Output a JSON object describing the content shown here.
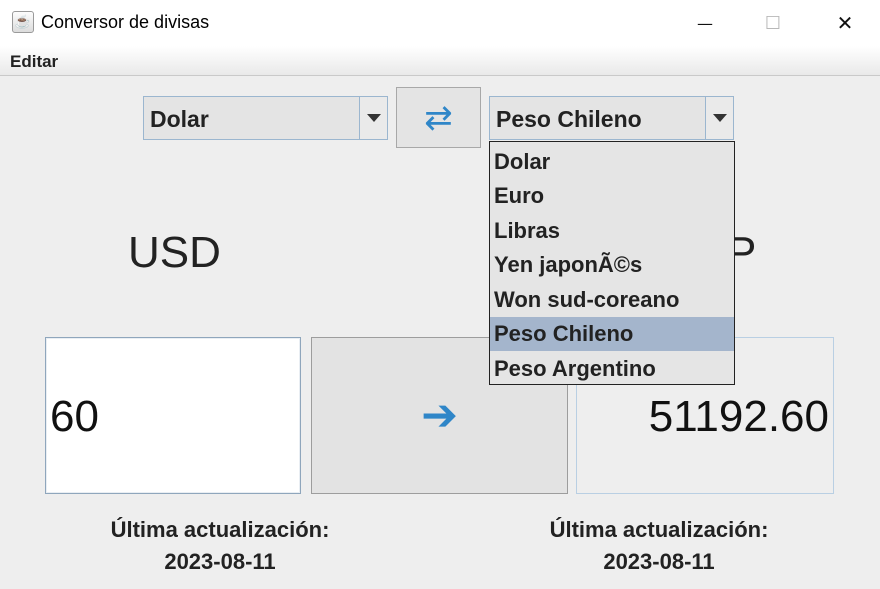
{
  "window": {
    "title": "Conversor de divisas",
    "controls": {
      "minimize": "—",
      "maximize": "☐",
      "close": "✕"
    }
  },
  "menu": {
    "items": [
      "Editar"
    ]
  },
  "converter": {
    "from_currency": "Dolar",
    "to_currency": "Peso Chileno",
    "from_code": "USD",
    "to_code_visible_fragment": "P",
    "amount": "60",
    "result": "51192.60",
    "swap_icon": "swap-arrows-icon",
    "convert_icon": "arrow-right-icon",
    "accent_color": "#2f86c8"
  },
  "dropdown": {
    "open": true,
    "options": [
      "Dolar",
      "Euro",
      "Libras",
      "Yen japonÃ©s",
      "Won sud-coreano",
      "Peso Chileno",
      "Peso Argentino"
    ],
    "selected_index": 5,
    "highlight_color": "#a4b5cc"
  },
  "updates": {
    "left": {
      "label": "Última actualización:",
      "date": "2023-08-11"
    },
    "right": {
      "label": "Última actualización:",
      "date": "2023-08-11"
    }
  }
}
